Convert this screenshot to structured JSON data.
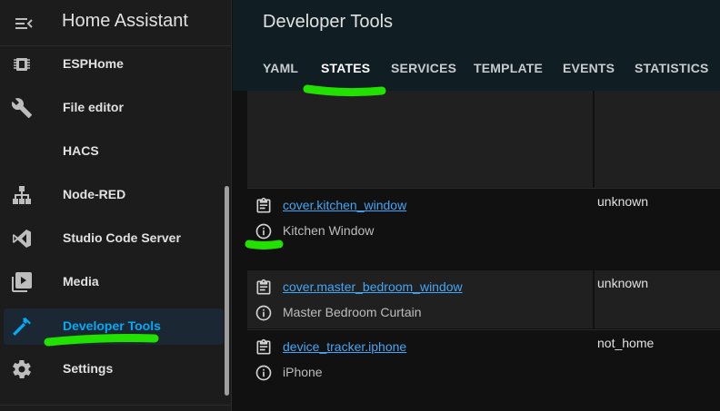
{
  "sidebar": {
    "title": "Home Assistant",
    "items": [
      {
        "label": "ESPHome",
        "icon": "chip-icon"
      },
      {
        "label": "File editor",
        "icon": "wrench-icon"
      },
      {
        "label": "HACS",
        "icon": ""
      },
      {
        "label": "Node-RED",
        "icon": "sitemap-icon"
      },
      {
        "label": "Studio Code Server",
        "icon": "vscode-icon"
      },
      {
        "label": "Media",
        "icon": "media-icon"
      },
      {
        "label": "Developer Tools",
        "icon": "hammer-icon",
        "active": true
      },
      {
        "label": "Settings",
        "icon": "gear-icon"
      }
    ]
  },
  "header": {
    "title": "Developer Tools",
    "tabs": [
      {
        "label": "YAML"
      },
      {
        "label": "STATES",
        "active": true
      },
      {
        "label": "SERVICES"
      },
      {
        "label": "TEMPLATE"
      },
      {
        "label": "EVENTS"
      },
      {
        "label": "STATISTICS"
      }
    ]
  },
  "entities": [
    {
      "entity_id": "cover.kitchen_window",
      "name": "Kitchen Window",
      "state": "unknown"
    },
    {
      "entity_id": "cover.master_bedroom_window",
      "name": "Master Bedroom Curtain",
      "state": "unknown"
    },
    {
      "entity_id": "device_tracker.iphone",
      "name": "iPhone",
      "state": "not_home"
    }
  ],
  "colors": {
    "accent": "#03a9f4",
    "link": "#42a5f5",
    "highlight": "#22e000"
  }
}
